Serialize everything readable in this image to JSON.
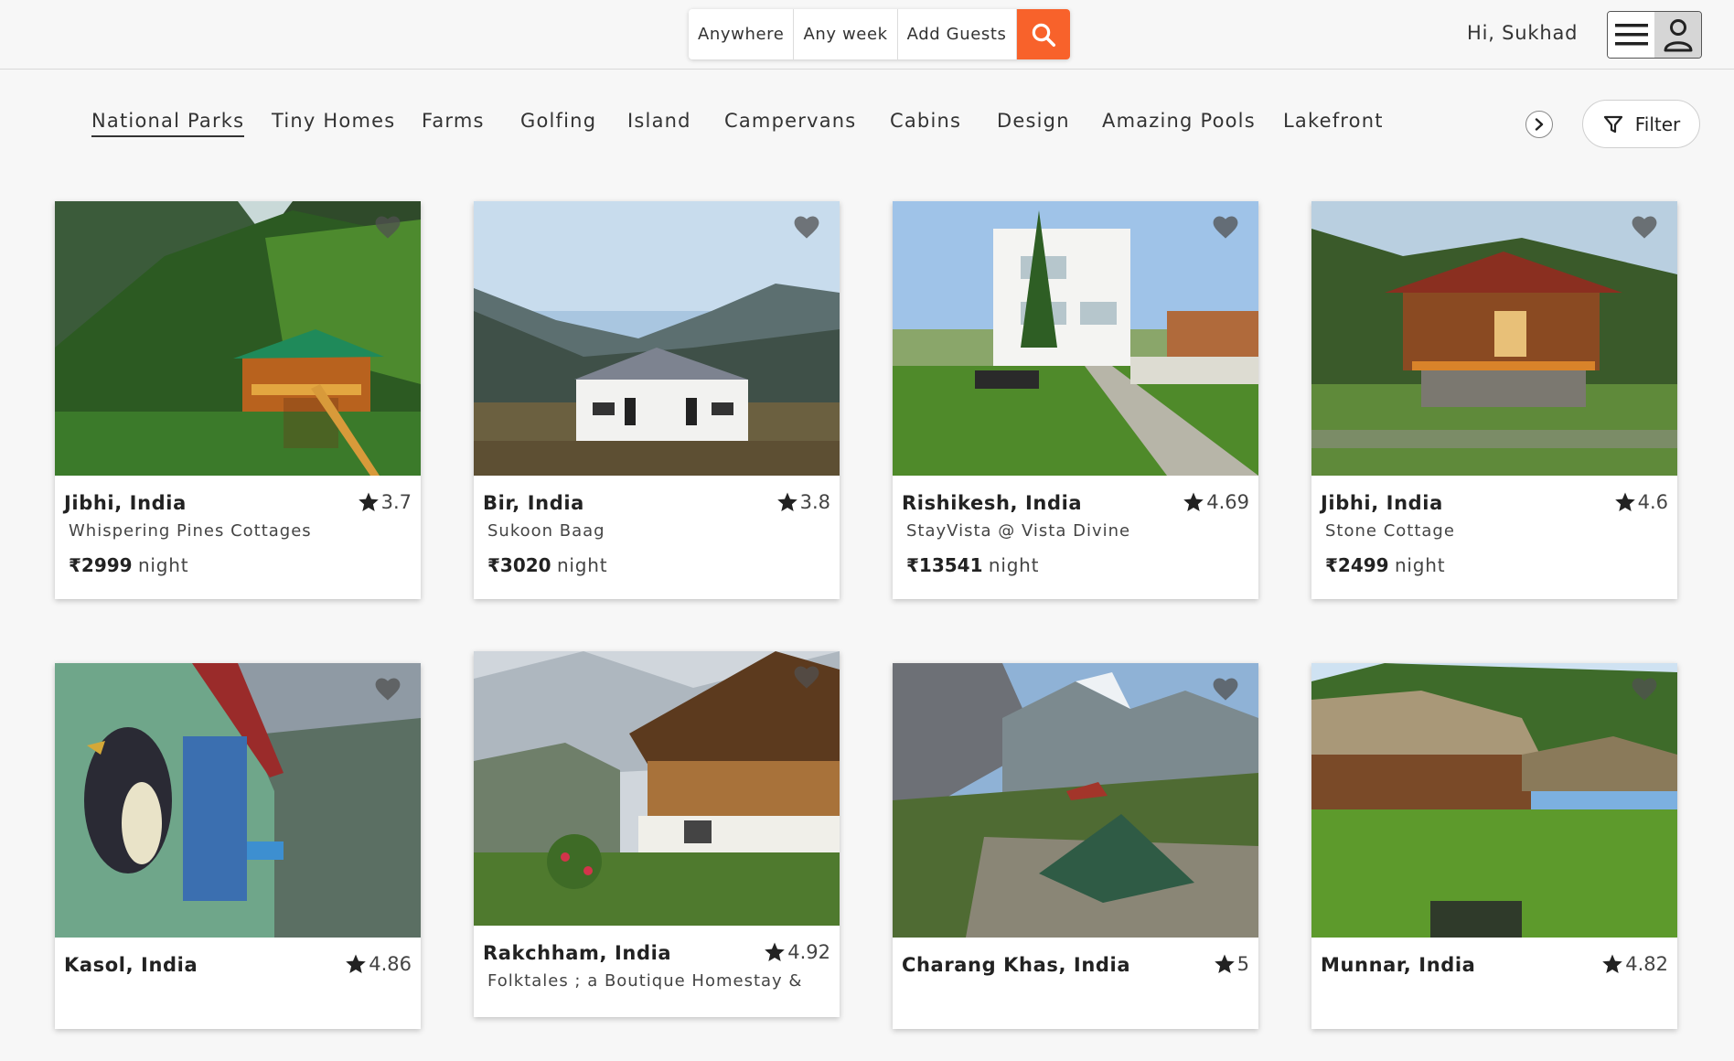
{
  "search": {
    "anywhere": "Anywhere",
    "any_week": "Any week",
    "add_guests": "Add Guests",
    "accent": "#f8622b"
  },
  "user": {
    "greeting": "Hi, Sukhad"
  },
  "categories": [
    {
      "label": "National Parks",
      "active": true
    },
    {
      "label": "Tiny Homes"
    },
    {
      "label": "Farms"
    },
    {
      "label": "Golfing"
    },
    {
      "label": "Island"
    },
    {
      "label": "Campervans"
    },
    {
      "label": "Cabins"
    },
    {
      "label": "Design"
    },
    {
      "label": "Amazing Pools"
    },
    {
      "label": "Lakefront"
    }
  ],
  "filter": {
    "label": "Filter"
  },
  "listings": [
    {
      "location": "Jibhi, India",
      "rating": "3.7",
      "name": "Whispering Pines Cottages",
      "price": "₹2999",
      "unit": "night"
    },
    {
      "location": "Bir, India",
      "rating": "3.8",
      "name": "Sukoon Baag",
      "price": "₹3020",
      "unit": "night"
    },
    {
      "location": "Rishikesh, India",
      "rating": "4.69",
      "name": "StayVista @ Vista Divine",
      "price": "₹13541",
      "unit": "night"
    },
    {
      "location": "Jibhi, India",
      "rating": "4.6",
      "name": "Stone Cottage",
      "price": "₹2499",
      "unit": "night"
    },
    {
      "location": "Kasol, India",
      "rating": "4.86",
      "name": "",
      "price": "",
      "unit": ""
    },
    {
      "location": "Rakchham, India",
      "rating": "4.92",
      "name": "Folktales ; a Boutique Homestay &",
      "price": "",
      "unit": ""
    },
    {
      "location": "Charang Khas, India",
      "rating": "5",
      "name": "",
      "price": "",
      "unit": ""
    },
    {
      "location": "Munnar, India",
      "rating": "4.82",
      "name": "",
      "price": "",
      "unit": ""
    }
  ]
}
